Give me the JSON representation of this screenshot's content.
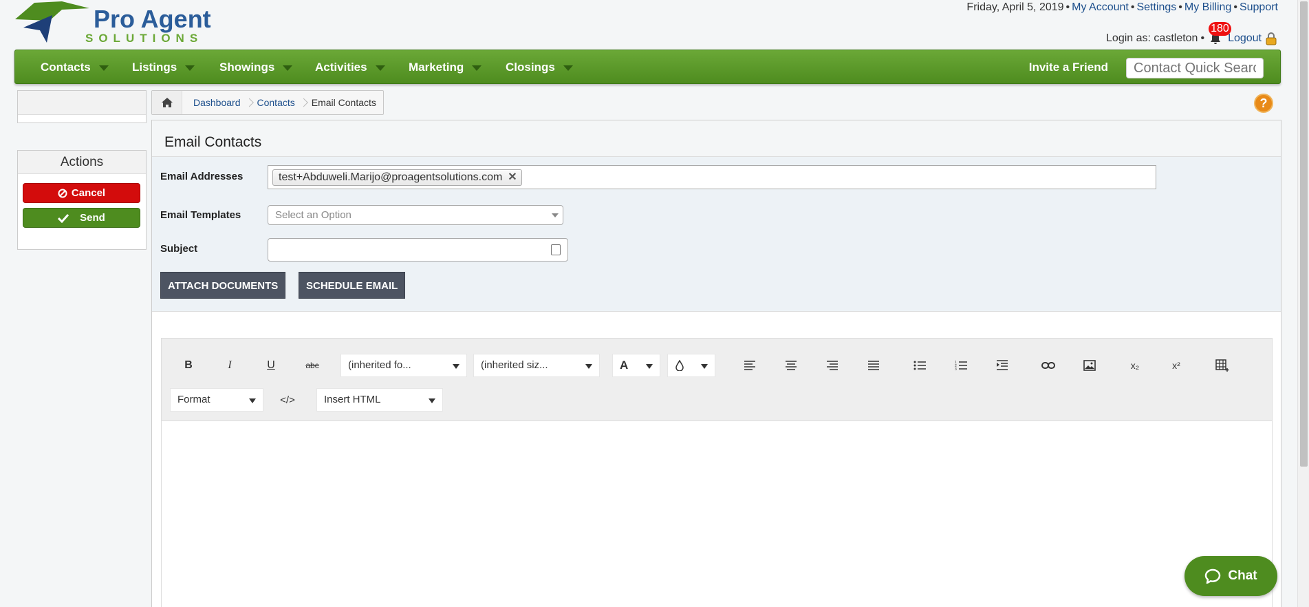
{
  "brand": {
    "name": "Pro Agent",
    "tagline": "SOLUTIONS",
    "primary_color": "#2b5d9a",
    "accent_color": "#6ba837"
  },
  "header": {
    "date": "Friday, April 5, 2019",
    "links": [
      "My Account",
      "Settings",
      "My Billing",
      "Support"
    ],
    "login_label": "Login as: castleton",
    "notification_count": "180",
    "logout": "Logout"
  },
  "nav": {
    "items": [
      "Contacts",
      "Listings",
      "Showings",
      "Activities",
      "Marketing",
      "Closings"
    ],
    "invite": "Invite a Friend",
    "search_placeholder": "Contact Quick Search"
  },
  "breadcrumb": [
    "Dashboard",
    "Contacts",
    "Email Contacts"
  ],
  "help": "?",
  "actions": {
    "title": "Actions",
    "cancel": "Cancel",
    "send": "Send"
  },
  "form": {
    "title": "Email Contacts",
    "email_label": "Email Addresses",
    "email_tag": "test+Abduweli.Marijo@proagentsolutions.com",
    "template_label": "Email Templates",
    "template_placeholder": "Select an Option",
    "subject_label": "Subject",
    "subject_value": "",
    "attach_button": "ATTACH DOCUMENTS",
    "schedule_button": "SCHEDULE EMAIL"
  },
  "editor": {
    "bold": "B",
    "italic": "I",
    "underline": "U",
    "strike": "abc",
    "font_family": "(inherited fo...",
    "font_size": "(inherited siz...",
    "font_color": "A",
    "format": "Format",
    "code": "</>",
    "insert_html": "Insert HTML",
    "subscript": "x₂",
    "superscript": "x²"
  },
  "chat": {
    "label": "Chat",
    "color": "#4e8c1f"
  }
}
